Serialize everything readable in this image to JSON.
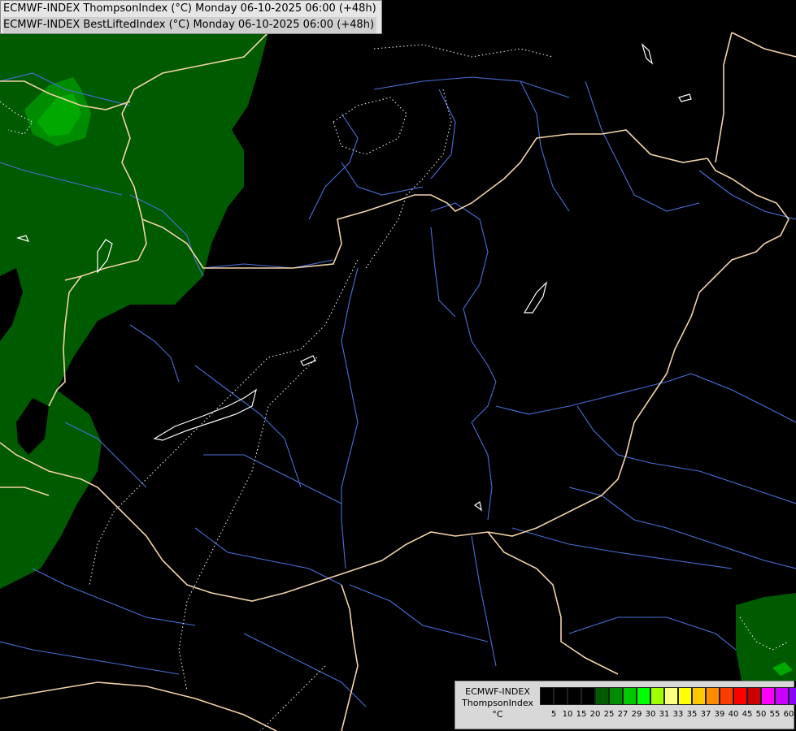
{
  "header": {
    "line1": "ECMWF-INDEX ThompsonIndex (°C) Monday 06-10-2025 06:00 (+48h)",
    "line2": "ECMWF-INDEX BestLiftedIndex (°C) Monday 06-10-2025 06:00 (+48h)"
  },
  "colors": {
    "background": "#000000",
    "green_dark": "#005a00",
    "green_mid": "#008c00",
    "green_light": "#00b400",
    "border": "#f2d3a8",
    "river": "#4a6fd8",
    "contour": "#ffffff"
  },
  "legend": {
    "line1": "ECMWF-INDEX",
    "line2": "ThompsonIndex",
    "line3": "°C",
    "colors": [
      "#000000",
      "#000000",
      "#000000",
      "#000000",
      "#005a00",
      "#008c00",
      "#00c800",
      "#00ff00",
      "#a0ff00",
      "#ffff80",
      "#ffff00",
      "#ffc800",
      "#ff8c00",
      "#ff3c00",
      "#ff0000",
      "#c80000",
      "#ff00ff",
      "#c800ff",
      "#8c00ff",
      "#5000ff",
      "#0000ff"
    ],
    "ticks": [
      "5",
      "10",
      "15",
      "20",
      "25",
      "27",
      "29",
      "30",
      "31",
      "33",
      "35",
      "37",
      "39",
      "40",
      "45",
      "50",
      "55",
      "60"
    ]
  }
}
